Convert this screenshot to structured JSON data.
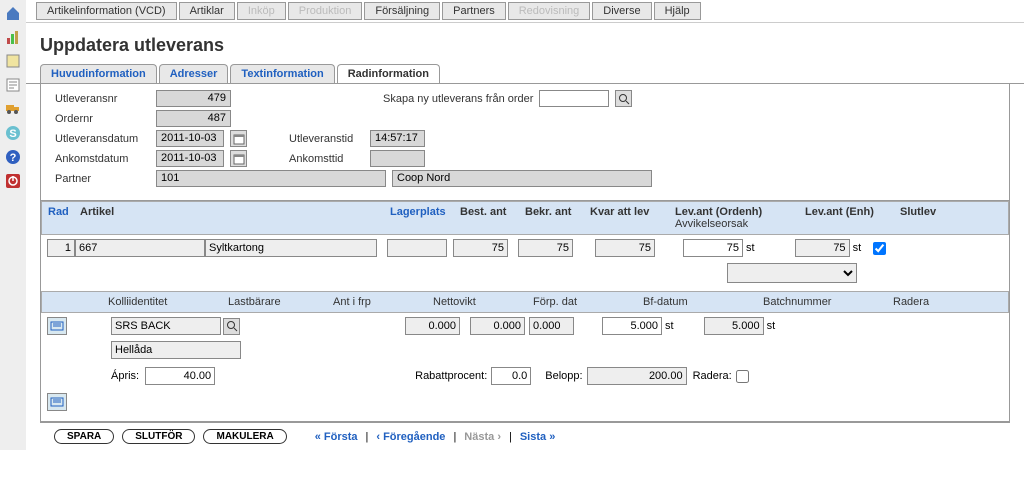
{
  "topmenu": [
    "Artikelinformation (VCD)",
    "Artiklar",
    "Inköp",
    "Produktion",
    "Försäljning",
    "Partners",
    "Redovisning",
    "Diverse",
    "Hjälp"
  ],
  "topmenu_disabled": [
    false,
    false,
    true,
    true,
    false,
    false,
    true,
    false,
    false
  ],
  "page_title": "Uppdatera utleverans",
  "subtabs": [
    "Huvudinformation",
    "Adresser",
    "Textinformation",
    "Radinformation"
  ],
  "subtab_active": 3,
  "fields": {
    "utleveransnr_lbl": "Utleveransnr",
    "utleveransnr": "479",
    "ordernr_lbl": "Ordernr",
    "ordernr": "487",
    "utleveransdatum_lbl": "Utleveransdatum",
    "utleveransdatum": "2011-10-03",
    "utleveranstid_lbl": "Utleveranstid",
    "utleveranstid": "14:57:17",
    "ankomstdatum_lbl": "Ankomstdatum",
    "ankomstdatum": "2011-10-03",
    "ankomsttid_lbl": "Ankomsttid",
    "ankomsttid": "",
    "partner_lbl": "Partner",
    "partner_code": "101",
    "partner_name": "Coop Nord",
    "skapa_lbl": "Skapa ny utleverans från order"
  },
  "grid1_headers": {
    "rad": "Rad",
    "artikel": "Artikel",
    "lagerplats": "Lagerplats",
    "best_ant": "Best. ant",
    "bekr_ant": "Bekr. ant",
    "kvar": "Kvar att lev",
    "lev_ordenh": "Lev.ant (Ordenh)",
    "avvikelse": "Avvikelseorsak",
    "lev_enh": "Lev.ant (Enh)",
    "slutlev": "Slutlev"
  },
  "grid1_row": {
    "rad": "1",
    "art_code": "667",
    "art_name": "Syltkartong",
    "lagerplats": "",
    "best_ant": "75",
    "bekr_ant": "75",
    "kvar": "75",
    "lev_ordenh": "75",
    "lev_ordenh_unit": "st",
    "lev_enh": "75",
    "lev_enh_unit": "st"
  },
  "grid2_headers": {
    "kolli": "Kolliidentitet",
    "lastbarare": "Lastbärare",
    "ant_i_frp": "Ant i frp",
    "nettovikt": "Nettovikt",
    "forp_dat": "Förp. dat",
    "bf_datum": "Bf-datum",
    "batchnummer": "Batchnummer",
    "radera": "Radera"
  },
  "grid2_row": {
    "lastbarare1": "SRS BACK",
    "lastbarare2": "Hellåda",
    "nettovikt": "0.000",
    "forp_dat": "0.000",
    "bf_datum_ro": "0.000",
    "bf_datum_in": "5.000",
    "bf_unit": "st",
    "batch": "5.000",
    "batch_unit": "st"
  },
  "bottom_row": {
    "apris_lbl": "Ápris:",
    "apris": "40.00",
    "rabatt_lbl": "Rabattprocent:",
    "rabatt": "0.0",
    "belopp_lbl": "Belopp:",
    "belopp": "200.00",
    "radera_lbl": "Radera:"
  },
  "footer": {
    "spara": "SPARA",
    "slutfor": "SLUTFÖR",
    "makulera": "MAKULERA",
    "forsta": "« Första",
    "foregaende": "‹ Föregående",
    "nasta": "Nästa ›",
    "sista": "Sista »",
    "sep": "|"
  }
}
